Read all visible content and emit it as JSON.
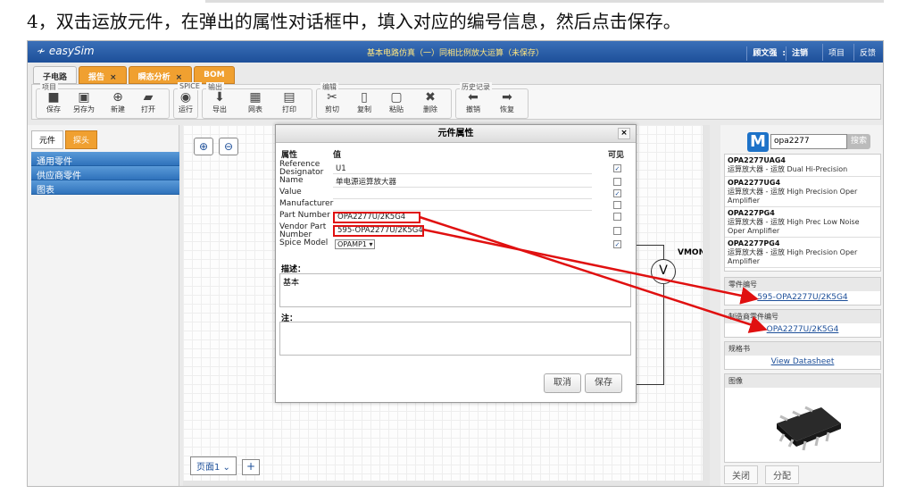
{
  "caption": "4，双击运放元件，在弹出的属性对话框中，填入对应的编号信息，然后点击保存。",
  "app": {
    "logo": "easySim",
    "title": "基本电路仿真（一）同相比例放大运算（未保存）",
    "user": "顾文强",
    "logout": "注销",
    "links": [
      "项目",
      "反馈"
    ]
  },
  "tabs": [
    {
      "label": "子电路",
      "close": ""
    },
    {
      "label": "报告",
      "close": "×"
    },
    {
      "label": "瞬态分析",
      "close": "×"
    },
    {
      "label": "BOM",
      "close": ""
    }
  ],
  "ribbon": {
    "groups": [
      "项目",
      "SPICE",
      "输出",
      "编辑",
      "历史记录"
    ],
    "buttons": [
      "保存",
      "另存为",
      "新建",
      "打开",
      "运行",
      "导出",
      "网表",
      "打印",
      "剪切",
      "复制",
      "粘贴",
      "删除",
      "撤销",
      "恢复"
    ]
  },
  "left": {
    "tabs": [
      "元件",
      "探头"
    ],
    "rows": [
      "通用零件",
      "供应商零件",
      "图表"
    ]
  },
  "canvas": {
    "page": "页面1",
    "add": "+",
    "vmon_label": "VMON",
    "vmon_symbol": "V"
  },
  "dialog": {
    "title": "元件属性",
    "close": "×",
    "col_property": "属性",
    "col_value": "值",
    "col_visible": "可见",
    "props": [
      {
        "label": "Reference Designator",
        "value": "U1",
        "visible": true
      },
      {
        "label": "Name",
        "value": "单电源运算放大器",
        "visible": false
      },
      {
        "label": "Value",
        "value": "",
        "visible": true
      },
      {
        "label": "Manufacturer",
        "value": "",
        "visible": false
      },
      {
        "label": "Part Number",
        "value": "OPA2277U/2K5G4",
        "visible": false
      },
      {
        "label": "Vendor Part Number",
        "value": "595-OPA2277U/2K5G4",
        "visible": false
      },
      {
        "label": "Spice Model",
        "value": "OPAMP1",
        "visible": true
      }
    ],
    "desc_label": "描述：",
    "desc_value": "基本",
    "note_label": "注：",
    "note_value": "",
    "cancel": "取消",
    "save": "保存"
  },
  "right": {
    "logo": "M",
    "search_value": "opa2277",
    "search_button": "搜索",
    "results": [
      {
        "name": "OPA2277UAG4",
        "desc": "运算放大器 - 运放 Dual Hi-Precision"
      },
      {
        "name": "OPA2277UG4",
        "desc": "运算放大器 - 运放 High Precision Oper Amplifier"
      },
      {
        "name": "OPA227PG4",
        "desc": "运算放大器 - 运放 High Prec Low Noise Oper Amplifier"
      },
      {
        "name": "OPA2277PG4",
        "desc": "运算放大器 - 运放 High Precision Oper Amplifier"
      }
    ],
    "part_no_label": "零件编号",
    "part_no_value": "595-OPA2277U/2K5G4",
    "mfr_no_label": "制造商零件编号",
    "mfr_no_value": "OPA2277U/2K5G4",
    "spec_label": "规格书",
    "spec_link": "View Datasheet",
    "image_label": "图像",
    "bottom": [
      "关闭",
      "分配"
    ]
  },
  "colors": {
    "accent": "#1d4f99",
    "tab_orange": "#f0a030",
    "highlight": "#e01010"
  }
}
